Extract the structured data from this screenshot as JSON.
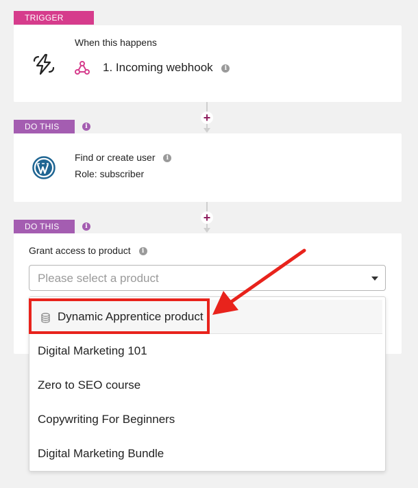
{
  "trigger": {
    "tag": "TRIGGER",
    "heading": "When this happens",
    "event": "1. Incoming webhook",
    "icon": "zap-icon",
    "event_icon": "webhook-icon"
  },
  "step1": {
    "tag": "DO THIS",
    "action": "Find or create user",
    "detail": "Role: subscriber",
    "icon": "wordpress-icon"
  },
  "step2": {
    "tag": "DO THIS",
    "label": "Grant access to product",
    "select_placeholder": "Please select a product",
    "options": [
      {
        "label": "Dynamic Apprentice product",
        "icon": "database-icon"
      },
      {
        "label": "Digital Marketing 101"
      },
      {
        "label": "Zero to SEO course"
      },
      {
        "label": "Copywriting For Beginners"
      },
      {
        "label": "Digital Marketing Bundle"
      }
    ]
  },
  "colors": {
    "trigger_tag": "#d63c8c",
    "do_tag": "#a45db1",
    "plus": "#8e1f5f",
    "highlight": "#e8231c"
  }
}
